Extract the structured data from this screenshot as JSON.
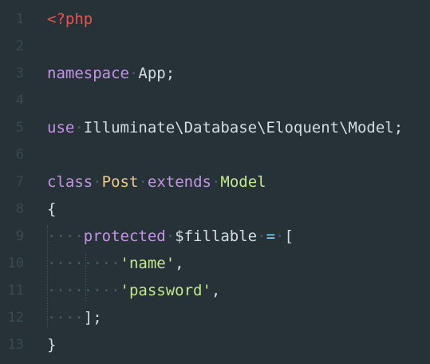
{
  "editor": {
    "lines": [
      {
        "number": "1",
        "tokens": [
          {
            "cls": "tok-php-tag",
            "text": "<?php"
          }
        ]
      },
      {
        "number": "2",
        "tokens": []
      },
      {
        "number": "3",
        "tokens": [
          {
            "cls": "tok-keyword",
            "text": "namespace"
          },
          {
            "cls": "tok-space-dot",
            "text": "·"
          },
          {
            "cls": "tok-plain",
            "text": "App;"
          }
        ]
      },
      {
        "number": "4",
        "tokens": []
      },
      {
        "number": "5",
        "tokens": [
          {
            "cls": "tok-keyword",
            "text": "use"
          },
          {
            "cls": "tok-space-dot",
            "text": "·"
          },
          {
            "cls": "tok-plain",
            "text": "Illuminate\\Database\\Eloquent\\Model;"
          }
        ]
      },
      {
        "number": "6",
        "tokens": []
      },
      {
        "number": "7",
        "tokens": [
          {
            "cls": "tok-keyword",
            "text": "class"
          },
          {
            "cls": "tok-space-dot",
            "text": "·"
          },
          {
            "cls": "tok-class-name",
            "text": "Post"
          },
          {
            "cls": "tok-space-dot",
            "text": "·"
          },
          {
            "cls": "tok-keyword",
            "text": "extends"
          },
          {
            "cls": "tok-space-dot",
            "text": "·"
          },
          {
            "cls": "tok-model-name",
            "text": "Model"
          }
        ]
      },
      {
        "number": "8",
        "tokens": [
          {
            "cls": "tok-plain",
            "text": "{"
          }
        ]
      },
      {
        "number": "9",
        "tokens": [
          {
            "cls": "tok-dots",
            "text": "····"
          },
          {
            "cls": "tok-keyword",
            "text": "protected"
          },
          {
            "cls": "tok-space-dot",
            "text": "·"
          },
          {
            "cls": "tok-variable",
            "text": "$fillable"
          },
          {
            "cls": "tok-space-dot",
            "text": "·"
          },
          {
            "cls": "tok-operator",
            "text": "="
          },
          {
            "cls": "tok-space-dot",
            "text": "·"
          },
          {
            "cls": "tok-plain",
            "text": "["
          }
        ]
      },
      {
        "number": "10",
        "tokens": [
          {
            "cls": "tok-dots",
            "text": "········"
          },
          {
            "cls": "tok-string",
            "text": "'name'"
          },
          {
            "cls": "tok-plain",
            "text": ","
          }
        ]
      },
      {
        "number": "11",
        "tokens": [
          {
            "cls": "tok-dots",
            "text": "········"
          },
          {
            "cls": "tok-string",
            "text": "'password'"
          },
          {
            "cls": "tok-plain",
            "text": ","
          }
        ]
      },
      {
        "number": "12",
        "tokens": [
          {
            "cls": "tok-dots",
            "text": "····"
          },
          {
            "cls": "tok-plain",
            "text": "];"
          }
        ]
      },
      {
        "number": "13",
        "tokens": [
          {
            "cls": "tok-plain",
            "text": "}"
          }
        ]
      }
    ]
  }
}
